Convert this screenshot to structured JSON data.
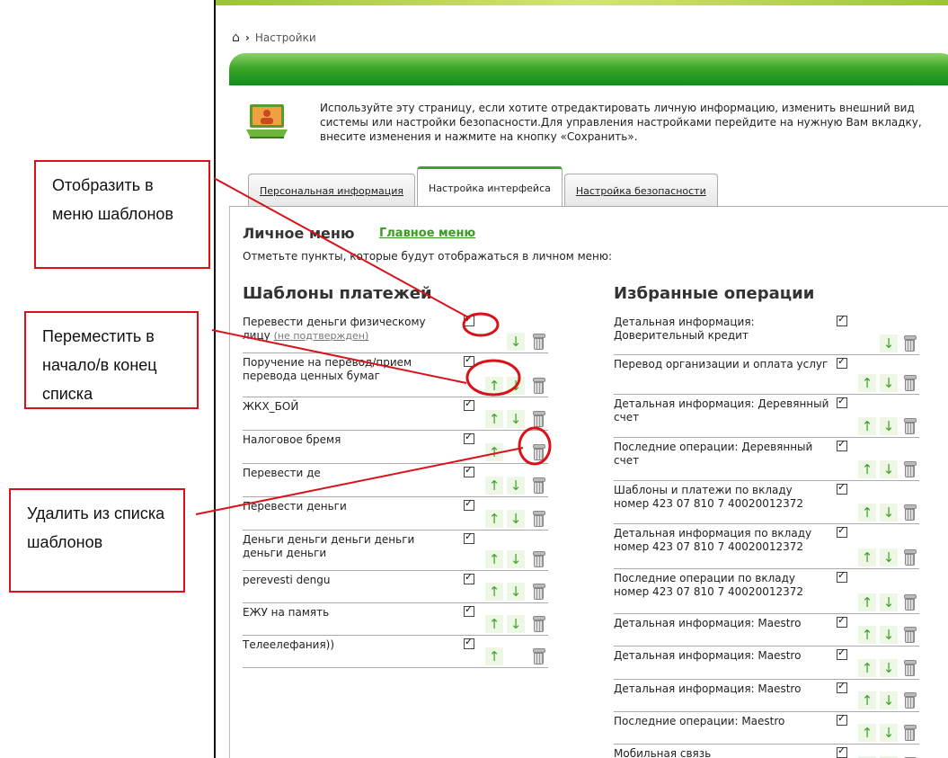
{
  "breadcrumb": {
    "home_icon": "home-icon",
    "separator": "›",
    "current": "Настройки"
  },
  "intro": {
    "icon": "laptop-user-icon",
    "text": "Используйте эту страницу, если хотите отредактировать личную информацию, изменить внешний вид системы или настройки безопасности.Для управления настройками перейдите на нужную Вам вкладку, внесите изменения и нажмите на кнопку «Сохранить»."
  },
  "tabs": [
    {
      "label": "Персональная информация",
      "active": false
    },
    {
      "label": "Настройка интерфейса",
      "active": true
    },
    {
      "label": "Настройка безопасности",
      "active": false
    }
  ],
  "personal_menu": {
    "title": "Личное меню",
    "main_menu_link": "Главное меню",
    "description": "Отметьте пункты, которые будут отображаться в личном меню:"
  },
  "templates": {
    "title": "Шаблоны платежей",
    "items": [
      {
        "label": "Перевести деньги физическому лицу",
        "note": "(не подтвержден)",
        "checked": true,
        "up": false,
        "down": true
      },
      {
        "label": "Поручение на перевод/прием перевода ценных бумаг",
        "checked": true,
        "up": true,
        "down": true
      },
      {
        "label": "ЖКХ_БОЙ",
        "checked": true,
        "up": true,
        "down": true
      },
      {
        "label": "Налоговое бремя",
        "checked": true,
        "up": true,
        "down": false
      },
      {
        "label": "Перевести де",
        "checked": true,
        "up": true,
        "down": true
      },
      {
        "label": "Перевести деньги",
        "checked": true,
        "up": true,
        "down": true
      },
      {
        "label": "Деньги деньги деньги деньги деньги деньги",
        "checked": true,
        "up": true,
        "down": true
      },
      {
        "label": "perevesti dengu",
        "checked": true,
        "up": true,
        "down": true
      },
      {
        "label": "ЕЖУ на память",
        "checked": true,
        "up": true,
        "down": true
      },
      {
        "label": "Телеелефания))",
        "checked": true,
        "up": true,
        "down": false
      }
    ]
  },
  "favorites": {
    "title": "Избранные операции",
    "items": [
      {
        "label": "Детальная информация: Доверительный кредит",
        "checked": true,
        "up": false,
        "down": true
      },
      {
        "label": "Перевод организации и оплата услуг",
        "checked": true,
        "up": true,
        "down": true
      },
      {
        "label": "Детальная информация: Деревянный счет",
        "checked": true,
        "up": true,
        "down": true
      },
      {
        "label": "Последние операции: Деревянный счет",
        "checked": true,
        "up": true,
        "down": true
      },
      {
        "label": "Шаблоны и платежи по вкладу номер 423 07 810 7 40020012372",
        "checked": true,
        "up": true,
        "down": true
      },
      {
        "label": "Детальная информация по вкладу номер 423 07 810 7 40020012372",
        "checked": true,
        "up": true,
        "down": true
      },
      {
        "label": "Последние операции по вкладу номер 423 07 810 7 40020012372",
        "checked": true,
        "up": true,
        "down": true
      },
      {
        "label": "Детальная информация: Maestro",
        "checked": true,
        "up": true,
        "down": true
      },
      {
        "label": "Детальная информация: Maestro",
        "checked": true,
        "up": true,
        "down": true
      },
      {
        "label": "Детальная информация: Maestro",
        "checked": true,
        "up": true,
        "down": true
      },
      {
        "label": "Последние операции: Maestro",
        "checked": true,
        "up": true,
        "down": true
      },
      {
        "label": "Мобильная связь",
        "checked": true,
        "up": true,
        "down": true
      }
    ]
  },
  "annotations": [
    {
      "text": "Отобразить в меню шаблонов"
    },
    {
      "text": "Переместить в начало/в конец списка"
    },
    {
      "text": "Удалить из списка шаблонов"
    }
  ],
  "colors": {
    "accent_green": "#3da629",
    "annotation_red": "#d9121a"
  }
}
